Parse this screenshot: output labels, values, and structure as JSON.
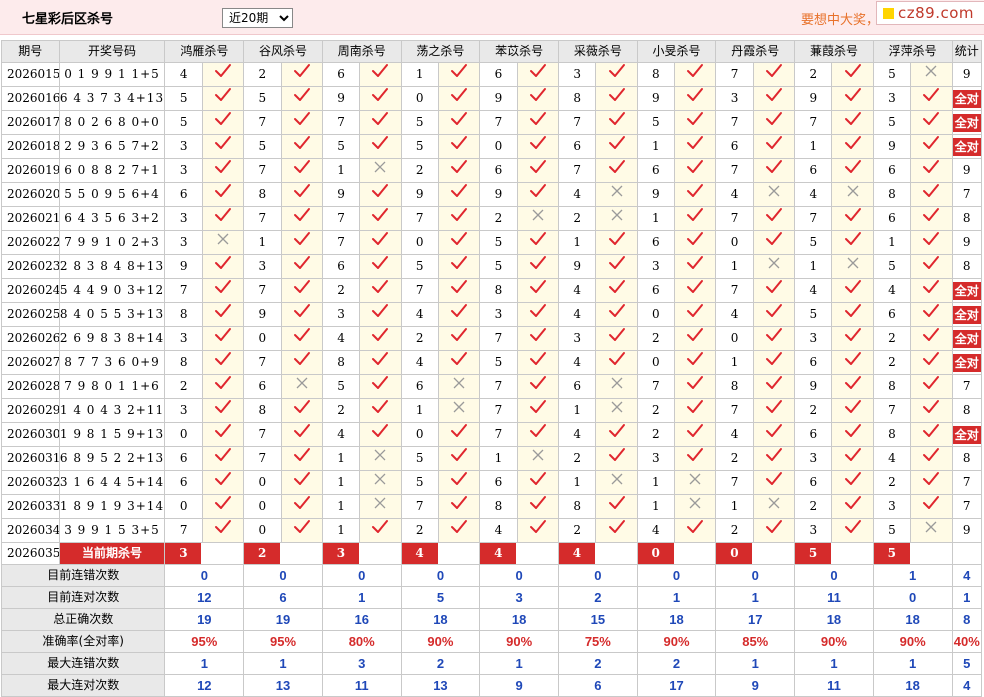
{
  "header": {
    "title": "七星彩后区杀号",
    "period_select": {
      "value": "近20期",
      "options": [
        "近20期"
      ]
    },
    "promo_text": "要想中大奖，",
    "site_badge": "cz89.com"
  },
  "columns": {
    "issue": "期号",
    "draw": "开奖号码",
    "experts": [
      "鸿雁杀号",
      "谷风杀号",
      "周南杀号",
      "荡之杀号",
      "苯苡杀号",
      "采薇杀号",
      "小旻杀号",
      "丹霞杀号",
      "蒹葭杀号",
      "浮萍杀号"
    ],
    "total": "统计"
  },
  "rows": [
    {
      "issue": "2026015",
      "draw": "0 1 9 9 1 1+5",
      "kills": [
        4,
        2,
        6,
        1,
        6,
        3,
        8,
        7,
        2,
        5
      ],
      "hits": [
        1,
        1,
        1,
        1,
        1,
        1,
        1,
        1,
        1,
        0
      ],
      "total": "9"
    },
    {
      "issue": "2026016",
      "draw": "6 4 3 7 3 4+13",
      "kills": [
        5,
        5,
        9,
        0,
        9,
        8,
        9,
        3,
        9,
        3
      ],
      "hits": [
        1,
        1,
        1,
        1,
        1,
        1,
        1,
        1,
        1,
        1
      ],
      "total": "全对"
    },
    {
      "issue": "2026017",
      "draw": "8 0 2 6 8 0+0",
      "kills": [
        5,
        7,
        7,
        5,
        7,
        7,
        5,
        7,
        7,
        5
      ],
      "hits": [
        1,
        1,
        1,
        1,
        1,
        1,
        1,
        1,
        1,
        1
      ],
      "total": "全对"
    },
    {
      "issue": "2026018",
      "draw": "2 9 3 6 5 7+2",
      "kills": [
        3,
        5,
        5,
        5,
        0,
        6,
        1,
        6,
        1,
        9
      ],
      "hits": [
        1,
        1,
        1,
        1,
        1,
        1,
        1,
        1,
        1,
        1
      ],
      "total": "全对"
    },
    {
      "issue": "2026019",
      "draw": "6 0 8 8 2 7+1",
      "kills": [
        3,
        7,
        1,
        2,
        6,
        7,
        6,
        7,
        6,
        6
      ],
      "hits": [
        1,
        1,
        0,
        1,
        1,
        1,
        1,
        1,
        1,
        1
      ],
      "total": "9"
    },
    {
      "issue": "2026020",
      "draw": "5 5 0 9 5 6+4",
      "kills": [
        6,
        8,
        9,
        9,
        9,
        4,
        9,
        4,
        4,
        8
      ],
      "hits": [
        1,
        1,
        1,
        1,
        1,
        0,
        1,
        0,
        0,
        1
      ],
      "total": "7"
    },
    {
      "issue": "2026021",
      "draw": "6 4 3 5 6 3+2",
      "kills": [
        3,
        7,
        7,
        7,
        2,
        2,
        1,
        7,
        7,
        6
      ],
      "hits": [
        1,
        1,
        1,
        1,
        0,
        0,
        1,
        1,
        1,
        1
      ],
      "total": "8"
    },
    {
      "issue": "2026022",
      "draw": "7 9 9 1 0 2+3",
      "kills": [
        3,
        1,
        7,
        0,
        5,
        1,
        6,
        0,
        5,
        1
      ],
      "hits": [
        0,
        1,
        1,
        1,
        1,
        1,
        1,
        1,
        1,
        1
      ],
      "total": "9"
    },
    {
      "issue": "2026023",
      "draw": "2 8 3 8 4 8+13",
      "kills": [
        9,
        3,
        6,
        5,
        5,
        9,
        3,
        1,
        1,
        5
      ],
      "hits": [
        1,
        1,
        1,
        1,
        1,
        1,
        1,
        0,
        0,
        1
      ],
      "total": "8"
    },
    {
      "issue": "2026024",
      "draw": "5 4 4 9 0 3+12",
      "kills": [
        7,
        7,
        2,
        7,
        8,
        4,
        6,
        7,
        4,
        4
      ],
      "hits": [
        1,
        1,
        1,
        1,
        1,
        1,
        1,
        1,
        1,
        1
      ],
      "total": "全对"
    },
    {
      "issue": "2026025",
      "draw": "8 4 0 5 5 3+13",
      "kills": [
        8,
        9,
        3,
        4,
        3,
        4,
        0,
        4,
        5,
        6
      ],
      "hits": [
        1,
        1,
        1,
        1,
        1,
        1,
        1,
        1,
        1,
        1
      ],
      "total": "全对"
    },
    {
      "issue": "2026026",
      "draw": "2 6 9 8 3 8+14",
      "kills": [
        3,
        0,
        4,
        2,
        7,
        3,
        2,
        0,
        3,
        2
      ],
      "hits": [
        1,
        1,
        1,
        1,
        1,
        1,
        1,
        1,
        1,
        1
      ],
      "total": "全对"
    },
    {
      "issue": "2026027",
      "draw": "8 7 7 3 6 0+9",
      "kills": [
        8,
        7,
        8,
        4,
        5,
        4,
        0,
        1,
        6,
        2
      ],
      "hits": [
        1,
        1,
        1,
        1,
        1,
        1,
        1,
        1,
        1,
        1
      ],
      "total": "全对"
    },
    {
      "issue": "2026028",
      "draw": "7 9 8 0 1 1+6",
      "kills": [
        2,
        6,
        5,
        6,
        7,
        6,
        7,
        8,
        9,
        8
      ],
      "hits": [
        1,
        0,
        1,
        0,
        1,
        0,
        1,
        1,
        1,
        1
      ],
      "total": "7"
    },
    {
      "issue": "2026029",
      "draw": "1 4 0 4 3 2+11",
      "kills": [
        3,
        8,
        2,
        1,
        7,
        1,
        2,
        7,
        2,
        7
      ],
      "hits": [
        1,
        1,
        1,
        0,
        1,
        0,
        1,
        1,
        1,
        1
      ],
      "total": "8"
    },
    {
      "issue": "2026030",
      "draw": "1 9 8 1 5 9+13",
      "kills": [
        0,
        7,
        4,
        0,
        7,
        4,
        2,
        4,
        6,
        8
      ],
      "hits": [
        1,
        1,
        1,
        1,
        1,
        1,
        1,
        1,
        1,
        1
      ],
      "total": "全对"
    },
    {
      "issue": "2026031",
      "draw": "6 8 9 5 2 2+13",
      "kills": [
        6,
        7,
        1,
        5,
        1,
        2,
        3,
        2,
        3,
        4
      ],
      "hits": [
        1,
        1,
        0,
        1,
        0,
        1,
        1,
        1,
        1,
        1
      ],
      "total": "8"
    },
    {
      "issue": "2026032",
      "draw": "3 1 6 4 4 5+14",
      "kills": [
        6,
        0,
        1,
        5,
        6,
        1,
        1,
        7,
        6,
        2
      ],
      "hits": [
        1,
        1,
        0,
        1,
        1,
        0,
        0,
        1,
        1,
        1
      ],
      "total": "7"
    },
    {
      "issue": "2026033",
      "draw": "1 8 9 1 9 3+14",
      "kills": [
        0,
        0,
        1,
        7,
        8,
        8,
        1,
        1,
        2,
        3
      ],
      "hits": [
        1,
        1,
        0,
        1,
        1,
        1,
        0,
        0,
        1,
        1
      ],
      "total": "7"
    },
    {
      "issue": "2026034",
      "draw": "3 9 9 1 5 3+5",
      "kills": [
        7,
        0,
        1,
        2,
        4,
        2,
        4,
        2,
        3,
        5
      ],
      "hits": [
        1,
        1,
        1,
        1,
        1,
        1,
        1,
        1,
        1,
        0
      ],
      "total": "9"
    }
  ],
  "current": {
    "issue": "2026035",
    "label": "当前期杀号",
    "kills": [
      "3",
      "2",
      "3",
      "4",
      "4",
      "4",
      "0",
      "0",
      "5",
      "5"
    ]
  },
  "stats": [
    {
      "label": "目前连错次数",
      "values": [
        "0",
        "0",
        "0",
        "0",
        "0",
        "0",
        "0",
        "0",
        "0",
        "1"
      ],
      "total": "4",
      "color": "blue"
    },
    {
      "label": "目前连对次数",
      "values": [
        "12",
        "6",
        "1",
        "5",
        "3",
        "2",
        "1",
        "1",
        "11",
        "0"
      ],
      "total": "1",
      "color": "blue"
    },
    {
      "label": "总正确次数",
      "values": [
        "19",
        "19",
        "16",
        "18",
        "18",
        "15",
        "18",
        "17",
        "18",
        "18"
      ],
      "total": "8",
      "color": "blue"
    },
    {
      "label": "准确率(全对率)",
      "values": [
        "95%",
        "95%",
        "80%",
        "90%",
        "90%",
        "75%",
        "90%",
        "85%",
        "90%",
        "90%"
      ],
      "total": "40%",
      "color": "red"
    },
    {
      "label": "最大连错次数",
      "values": [
        "1",
        "1",
        "3",
        "2",
        "1",
        "2",
        "2",
        "1",
        "1",
        "1"
      ],
      "total": "5",
      "color": "blue"
    },
    {
      "label": "最大连对次数",
      "values": [
        "12",
        "13",
        "11",
        "13",
        "9",
        "6",
        "17",
        "9",
        "11",
        "18"
      ],
      "total": "4",
      "color": "blue"
    }
  ],
  "icons": {
    "hit": "red-check-icon",
    "miss": "gray-cross-icon"
  },
  "colors": {
    "accent_red": "#d52b2b",
    "stat_blue": "#1f48b8",
    "check_red": "#e0262e",
    "cross_gray": "#9a9a9a",
    "header_bg": "#fdebec"
  }
}
